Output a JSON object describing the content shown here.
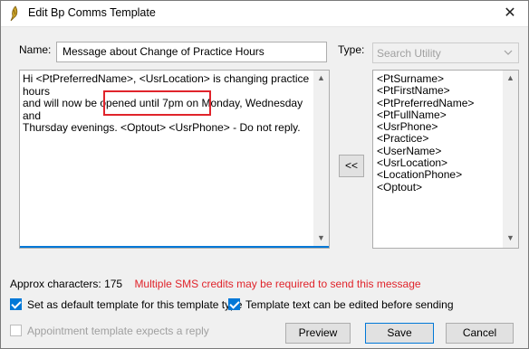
{
  "window": {
    "title": "Edit Bp Comms Template",
    "close_glyph": "✕"
  },
  "form": {
    "name_label": "Name:",
    "name_value": "Message about Change of Practice Hours",
    "type_label": "Type:",
    "type_placeholder": "Search Utility",
    "template_lines": [
      "Hi <PtPreferredName>, <UsrLocation> is changing practice hours",
      "and will now be opened until 7pm on Monday, Wednesday and",
      "Thursday evenings. <Optout> <UsrPhone> - Do not reply."
    ]
  },
  "fields_list": [
    "<PtSurname>",
    "<PtFirstName>",
    "<PtPreferredName>",
    "<PtFullName>",
    "<UsrPhone>",
    "<Practice>",
    "<UserName>",
    "<UsrLocation>",
    "<LocationPhone>",
    "<Optout>"
  ],
  "insert_button_label": "<<",
  "approx": {
    "label": "Approx characters:",
    "count": "175",
    "warning": "Multiple SMS credits may be required to send this message"
  },
  "options": {
    "default_template_label": "Set as default template for this template type",
    "editable_label": "Template text can be edited before sending",
    "appointment_label": "Appointment template expects a reply"
  },
  "buttons": {
    "preview": "Preview",
    "save": "Save",
    "cancel": "Cancel"
  },
  "colors": {
    "accent": "#0078d7",
    "warning": "#e0242b"
  }
}
